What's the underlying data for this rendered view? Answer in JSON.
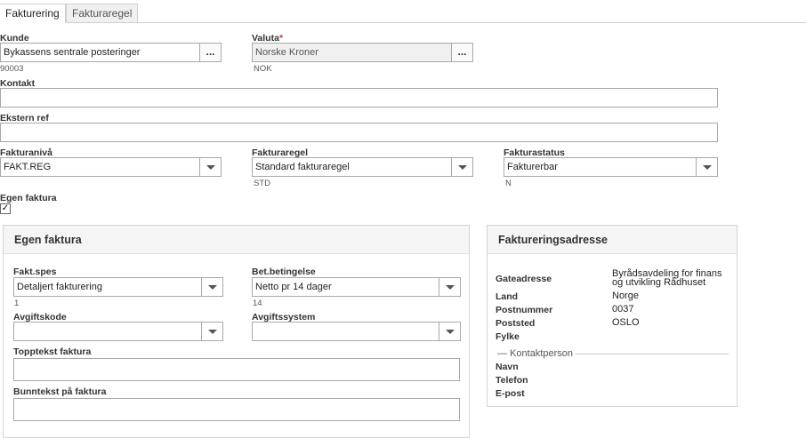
{
  "tabs": [
    {
      "label": "Fakturering",
      "active": true
    },
    {
      "label": "Fakturaregel",
      "active": false
    }
  ],
  "kunde": {
    "label": "Kunde",
    "value": "Bykassens sentrale posteringer",
    "sub": "90003",
    "button": "..."
  },
  "valuta": {
    "label": "Valuta",
    "required": "*",
    "value": "Norske Kroner",
    "sub": "NOK",
    "button": "..."
  },
  "kontakt": {
    "label": "Kontakt",
    "value": ""
  },
  "ekstern_ref": {
    "label": "Ekstern ref",
    "value": ""
  },
  "fakturaniva": {
    "label": "Fakturanivå",
    "value": "FAKT.REG"
  },
  "fakturaregel": {
    "label": "Fakturaregel",
    "value": "Standard fakturaregel",
    "sub": "STD"
  },
  "fakturastatus": {
    "label": "Fakturastatus",
    "value": "Fakturerbar",
    "sub": "N"
  },
  "egen_faktura": {
    "label": "Egen faktura",
    "checked": true,
    "mark": "✓"
  },
  "egen_panel": {
    "title": "Egen faktura",
    "fakt_spes": {
      "label": "Fakt.spes",
      "value": "Detaljert fakturering",
      "sub": "1"
    },
    "bet_betingelse": {
      "label": "Bet.betingelse",
      "value": "Netto pr 14 dager",
      "sub": "14"
    },
    "avgiftskode": {
      "label": "Avgiftskode",
      "value": ""
    },
    "avgiftssystem": {
      "label": "Avgiftssystem",
      "value": ""
    },
    "topptekst": {
      "label": "Topptekst faktura",
      "value": ""
    },
    "bunntekst": {
      "label": "Bunntekst på faktura",
      "value": ""
    }
  },
  "address_panel": {
    "title": "Faktureringsadresse",
    "gateadresse": {
      "label": "Gateadresse",
      "line1": "Byrådsavdeling for finans",
      "line2": "og utvikling Rådhuset"
    },
    "land": {
      "label": "Land",
      "value": "Norge"
    },
    "postnummer": {
      "label": "Postnummer",
      "value": "0037"
    },
    "poststed": {
      "label": "Poststed",
      "value": "OSLO"
    },
    "fylke": {
      "label": "Fylke",
      "value": ""
    },
    "kontaktperson_legend": "Kontaktperson",
    "navn": {
      "label": "Navn",
      "value": ""
    },
    "telefon": {
      "label": "Telefon",
      "value": ""
    },
    "epost": {
      "label": "E-post",
      "value": ""
    }
  }
}
